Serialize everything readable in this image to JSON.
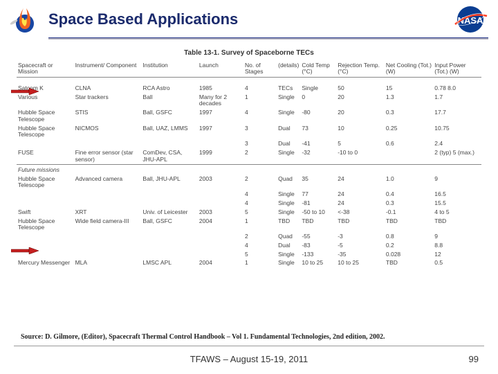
{
  "header": {
    "title": "Space Based Applications"
  },
  "table": {
    "caption": "Table 13-1. Survey of Spaceborne TECs",
    "columns": [
      "Spacecraft or Mission",
      "Instrument/ Component",
      "Institution",
      "Launch",
      "No. of Stages",
      "(details)",
      "Cold Temp (°C)",
      "Rejection Temp. (°C)",
      "Net Cooling (Tot.) (W)",
      "Input Power (Tot.) (W)"
    ],
    "sections": [
      {
        "label": "",
        "rows": [
          [
            "Satcom K",
            "CLNA",
            "RCA Astro",
            "1985",
            "4",
            "TECs",
            "Single",
            "50",
            "15",
            "0.78",
            "8.0"
          ],
          [
            "Various",
            "Star trackers",
            "Ball",
            "Many for 2 decades",
            "1",
            "Single",
            "0",
            "20",
            "1.3",
            "1.7"
          ],
          [
            "Hubble Space Telescope",
            "STIS",
            "Ball, GSFC",
            "1997",
            "4",
            "Single",
            "-80",
            "20",
            "0.3",
            "17.7"
          ],
          [
            "Hubble Space Telescope",
            "NICMOS",
            "Ball, UAZ, LMMS",
            "1997",
            "3",
            "Dual",
            "73",
            "10",
            "0.25",
            "10.75"
          ],
          [
            "",
            "",
            "",
            "",
            "3",
            "Dual",
            "-41",
            "5",
            "0.6",
            "2.4"
          ],
          [
            "FUSE",
            "Fine error sensor (star sensor)",
            "ComDev, CSA, JHU-APL",
            "1999",
            "2",
            "Single",
            "-32",
            "-10 to 0",
            "",
            "2 (typ) 5 (max.)"
          ]
        ]
      },
      {
        "label": "Future missions",
        "rows": [
          [
            "Hubble Space Telescope",
            "Advanced camera",
            "Ball, JHU-APL",
            "2003",
            "2",
            "Quad",
            "35",
            "24",
            "1.0",
            "9"
          ],
          [
            "",
            "",
            "",
            "",
            "4",
            "Single",
            "77",
            "24",
            "0.4",
            "16.5"
          ],
          [
            "",
            "",
            "",
            "",
            "4",
            "Single",
            "-81",
            "24",
            "0.3",
            "15.5"
          ],
          [
            "Swift",
            "XRT",
            "Univ. of Leicester",
            "2003",
            "5",
            "Single",
            "-50 to 10",
            "<-38",
            "-0.1",
            "4 to 5"
          ],
          [
            "Hubble Space Telescope",
            "Wide field camera-III",
            "Ball, GSFC",
            "2004",
            "1",
            "TBD",
            "TBD",
            "TBD",
            "TBD",
            "TBD"
          ],
          [
            "",
            "",
            "",
            "",
            "2",
            "Quad",
            "-55",
            "-3",
            "0.8",
            "9"
          ],
          [
            "",
            "",
            "",
            "",
            "4",
            "Dual",
            "-83",
            "-5",
            "0.2",
            "8.8"
          ],
          [
            "",
            "",
            "",
            "",
            "5",
            "Single",
            "-133",
            "-35",
            "0.028",
            "12"
          ],
          [
            "Mercury Messenger",
            "MLA",
            "LMSC APL",
            "2004",
            "1",
            "Single",
            "10 to 25",
            "10 to 25",
            "TBD",
            "0.5"
          ]
        ]
      }
    ]
  },
  "source": "Source: D. Gilmore, (Editor), Spacecraft Thermal Control Handbook – Vol 1. Fundamental Technologies, 2nd edition, 2002.",
  "footer": {
    "left": "TFAWS – August 15-19, 2011",
    "page": "99"
  },
  "arrows": {
    "top1": 124,
    "top2": 354
  }
}
